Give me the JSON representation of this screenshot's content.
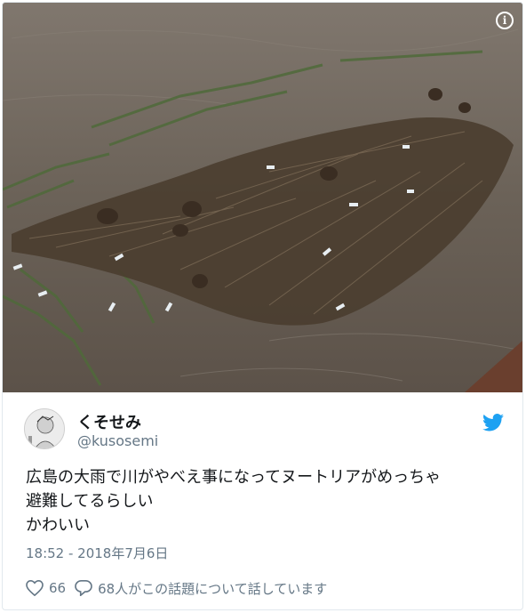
{
  "media": {
    "info_icon": "info-icon"
  },
  "user": {
    "display_name": "くそせみ",
    "username": "@kusosemi"
  },
  "tweet": {
    "lines": [
      "広島の大雨で川がやべえ事になってヌートリアがめっちゃ",
      "避難してるらしい",
      "かわいい"
    ],
    "timestamp": "18:52 - 2018年7月6日"
  },
  "actions": {
    "like_count": "66",
    "reply_label": "68人がこの話題について話しています"
  },
  "colors": {
    "twitter_blue": "#1da1f2",
    "muted_text": "#657786",
    "text": "#14171a"
  }
}
